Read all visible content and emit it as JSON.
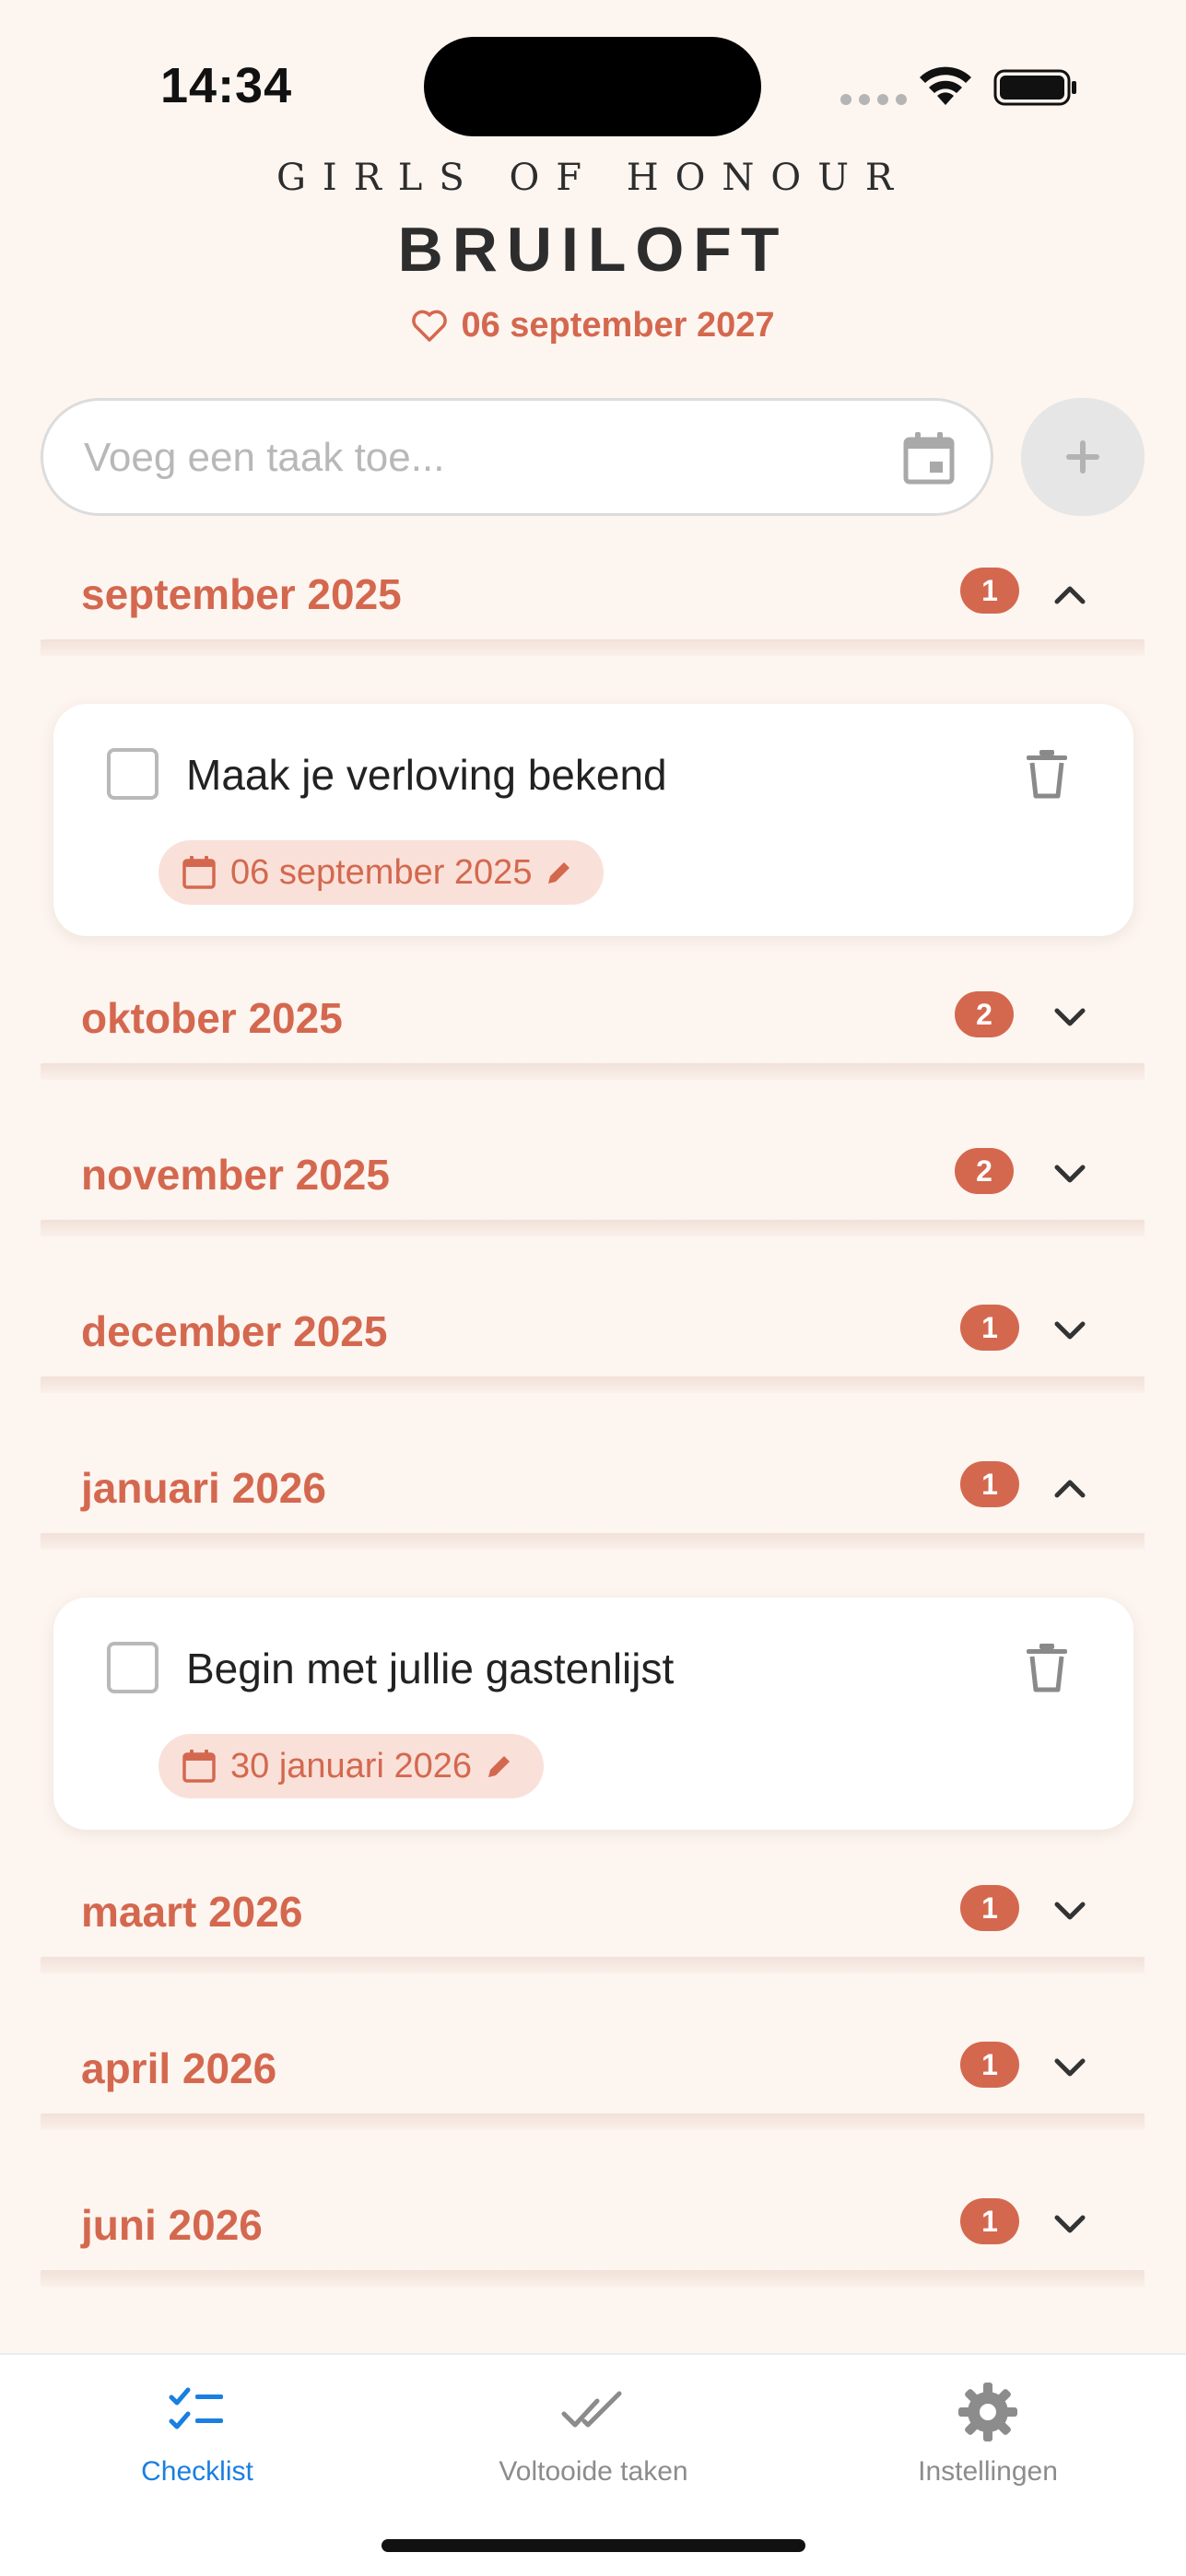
{
  "status_bar": {
    "time": "14:34"
  },
  "header": {
    "brand": "GIRLS OF HONOUR",
    "title": "BRUILOFT",
    "wedding_date": "06 september 2027"
  },
  "add_task": {
    "placeholder": "Voeg een taak toe...",
    "add_button_icon": "plus-icon"
  },
  "months": [
    {
      "label": "september 2025",
      "count": "1",
      "expanded": true
    },
    {
      "label": "oktober 2025",
      "count": "2",
      "expanded": false
    },
    {
      "label": "november 2025",
      "count": "2",
      "expanded": false
    },
    {
      "label": "december 2025",
      "count": "1",
      "expanded": false
    },
    {
      "label": "januari 2026",
      "count": "1",
      "expanded": true
    },
    {
      "label": "maart 2026",
      "count": "1",
      "expanded": false
    },
    {
      "label": "april 2026",
      "count": "1",
      "expanded": false
    },
    {
      "label": "juni 2026",
      "count": "1",
      "expanded": false
    }
  ],
  "tasks": [
    {
      "title": "Maak je verloving bekend",
      "date": "06 september 2025",
      "checked": false
    },
    {
      "title": "Begin met jullie gastenlijst",
      "date": "30 januari 2026",
      "checked": false
    }
  ],
  "bottom_nav": [
    {
      "label": "Checklist",
      "icon": "checklist-icon",
      "active": true
    },
    {
      "label": "Voltooide taken",
      "icon": "double-check-icon",
      "active": false
    },
    {
      "label": "Instellingen",
      "icon": "gear-icon",
      "active": false
    }
  ],
  "colors": {
    "accent": "#d4684f",
    "background": "#fdf5f0",
    "chip_bg": "#f9e1d9",
    "active_nav": "#1a7fe0"
  }
}
